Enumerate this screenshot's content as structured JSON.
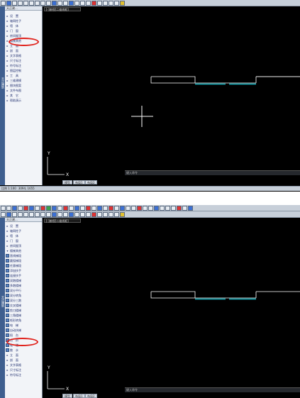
{
  "colors": {
    "canvas_bg": "#000000",
    "highlight": "#e0201a",
    "drawing_line": "#ffffff",
    "accent_line": "#16b6c4"
  },
  "top": {
    "sidebar_header": "天正建...",
    "doc_tab": "[-]俯视[二维线框]",
    "menu_items": [
      {
        "arrow": "▸",
        "label": "设　置"
      },
      {
        "arrow": "▸",
        "label": "轴网柱子"
      },
      {
        "arrow": "▸",
        "label": "墙　体"
      },
      {
        "arrow": "▸",
        "label": "门　窗"
      },
      {
        "arrow": "▸",
        "label": "房间屋顶"
      },
      {
        "arrow": "▸",
        "label": "楼梯其他"
      },
      {
        "arrow": "▸",
        "label": "立　面"
      },
      {
        "arrow": "▸",
        "label": "剖　面"
      },
      {
        "arrow": "▸",
        "label": "文字表格"
      },
      {
        "arrow": "▸",
        "label": "尺寸标注"
      },
      {
        "arrow": "▸",
        "label": "符号标注"
      },
      {
        "arrow": "▸",
        "label": "图层控制"
      },
      {
        "arrow": "▸",
        "label": "工　具"
      },
      {
        "arrow": "▸",
        "label": "三维建模"
      },
      {
        "arrow": "▸",
        "label": "图块图案"
      },
      {
        "arrow": "▸",
        "label": "文件布图"
      },
      {
        "arrow": "▸",
        "label": "其　它"
      },
      {
        "arrow": "▸",
        "label": "帮助演示"
      }
    ],
    "vtab_label": "天正建筑",
    "ucs_y": "Y",
    "ucs_x": "X",
    "cmd_prompt": "键入命令",
    "layout_tabs": [
      "模型",
      "布局1",
      "布局2"
    ],
    "status_text": "比例 1:100",
    "status_coords": "3094, 1655"
  },
  "bottom": {
    "sidebar_header": "天正建...",
    "doc_tab": "[-]俯视[二维线框]",
    "menu_items": [
      {
        "arrow": "▸",
        "label": "设　置"
      },
      {
        "arrow": "▸",
        "label": "轴网柱子"
      },
      {
        "arrow": "▸",
        "label": "墙　体"
      },
      {
        "arrow": "▸",
        "label": "门　窗"
      },
      {
        "arrow": "▸",
        "label": "房间屋顶"
      },
      {
        "arrow": "▾",
        "label": "楼梯其他"
      },
      {
        "ico": true,
        "label": "直线梯段"
      },
      {
        "ico": true,
        "label": "圆弧梯段"
      },
      {
        "ico": true,
        "label": "任意梯段"
      },
      {
        "ico": true,
        "label": "添加扶手"
      },
      {
        "ico": true,
        "label": "连接扶手"
      },
      {
        "ico": true,
        "label": "双跑楼梯"
      },
      {
        "ico": true,
        "label": "多跑楼梯"
      },
      {
        "ico": true,
        "label": "双分平行"
      },
      {
        "ico": true,
        "label": "双分转角"
      },
      {
        "ico": true,
        "label": "双分三跑"
      },
      {
        "ico": true,
        "label": "交叉楼梯"
      },
      {
        "ico": true,
        "label": "剪刀楼梯"
      },
      {
        "ico": true,
        "label": "三角楼梯"
      },
      {
        "ico": true,
        "label": "矩形转角"
      },
      {
        "ico": true,
        "label": "电　梯"
      },
      {
        "ico": true,
        "label": "自动扶梯"
      },
      {
        "ico": true,
        "label": "阳　台"
      },
      {
        "ico": true,
        "label": "台　阶"
      },
      {
        "ico": true,
        "label": "坡　道"
      },
      {
        "ico": true,
        "label": "散　水"
      },
      {
        "arrow": "▸",
        "label": "立　面"
      },
      {
        "arrow": "▸",
        "label": "剖　面"
      },
      {
        "arrow": "▸",
        "label": "文字表格"
      },
      {
        "arrow": "▸",
        "label": "尺寸标注"
      },
      {
        "arrow": "▸",
        "label": "符号标注"
      }
    ],
    "vtab_label": "天正建筑",
    "ucs_y": "Y",
    "ucs_x": "X",
    "cmd_prompt": "键入命令",
    "layout_tabs": [
      "模型",
      "布局1",
      "布局2"
    ]
  }
}
